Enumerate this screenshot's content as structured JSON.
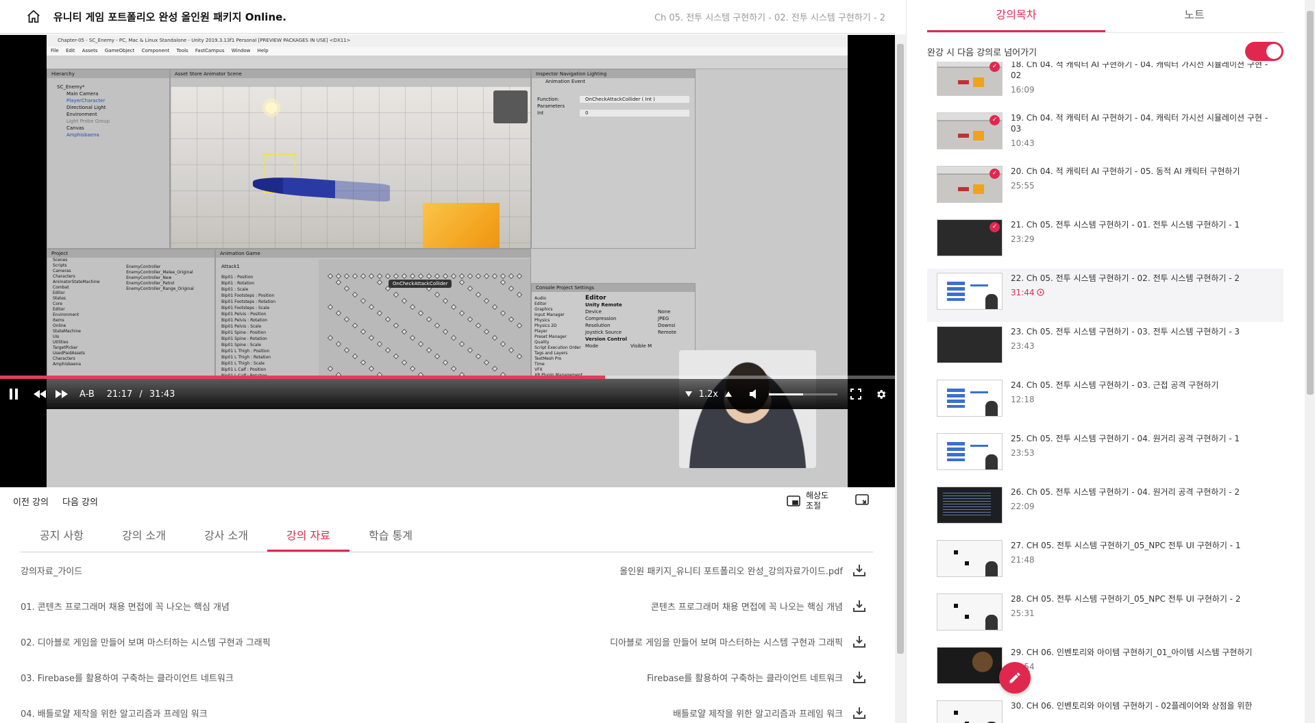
{
  "header": {
    "course_title": "유니티 게임 포트폴리오 완성 올인원 패키지 Online.",
    "lecture_crumb": "Ch 05. 전투 시스템 구현하기 - 02. 전투 시스템 구현하기 - 2"
  },
  "video": {
    "unity_title": "Chapter-05 - SC_Enemy - PC, Mac & Linux Standalone - Unity 2019.3.13f1 Personal [PREVIEW PACKAGES IN USE] <DX11>",
    "unity_menu": "File Edit Assets GameObject Component Tools FastCampus Window Help",
    "hierarchy_tab": "Hierarchy",
    "hierarchy_items": [
      "SC_Enemy*",
      "Main Camera",
      "PlayerCharacter",
      "Directional Light",
      "Environment",
      "Light Probe Group",
      "Canvas",
      "Amphisbaena"
    ],
    "scene_tabs": "Asset Store   Animator   Scene",
    "inspector_tabs": "Inspector   Navigation   Lighting",
    "inspector_title": "Animation Event",
    "inspector_function": "Function:",
    "inspector_function_value": "OnCheckAttackCollider ( Int )",
    "inspector_params": "Parameters",
    "inspector_int": "Int",
    "inspector_int_value": "0",
    "project_tab": "Project",
    "project_items": [
      "Scenes",
      "Scripts",
      "Cameras",
      "Characters",
      "AnimatorStateMachine",
      "Combat",
      "Editor",
      "States",
      "Core",
      "Editor",
      "Environment",
      "Items",
      "Online",
      "StateMachine",
      "UIs",
      "Utilities",
      "TargetPicker",
      "UsedPaidAssets",
      "Characters",
      "Amphisbaena"
    ],
    "search_results": [
      "EnemyController",
      "EnemyController_Melee_Original",
      "EnemyController_New",
      "EnemyController_Patrol",
      "EnemyController_Range_Original"
    ],
    "animation_tab": "Animation   Game",
    "animation_clip": "Attack1",
    "animation_tracks": [
      "Bip01 : Position",
      "Bip01 : Rotation",
      "Bip01 : Scale",
      "Bip01 Footsteps : Position",
      "Bip01 Footsteps : Rotation",
      "Bip01 Footsteps : Scale",
      "Bip01 Pelvis : Position",
      "Bip01 Pelvis : Rotation",
      "Bip01 Pelvis : Scale",
      "Bip01 Spine : Position",
      "Bip01 Spine : Rotation",
      "Bip01 Spine : Scale",
      "Bip01 L Thigh : Position",
      "Bip01 L Thigh : Rotation",
      "Bip01 L Thigh : Scale",
      "Bip01 L Calf : Position",
      "Bip01 L Calf : Rotation"
    ],
    "event_tooltip": "OnCheckAttackCollider",
    "settings_tabs": "Console   Project Settings",
    "settings_items": [
      "Audio",
      "Editor",
      "Graphics",
      "Input Manager",
      "Physics",
      "Physics 2D",
      "Player",
      "Preset Manager",
      "Quality",
      "Script Execution Order",
      "Tags and Layers",
      "TextMesh Pro",
      "Time",
      "VFX",
      "XR Plugin Management"
    ],
    "editor_heading": "Editor",
    "editor_unity_remote": "Unity Remote",
    "editor_labels": [
      "Device",
      "Compression",
      "Resolution",
      "Joystick Source"
    ],
    "editor_values": [
      "None",
      "JPEG",
      "Downsi",
      "Remote"
    ],
    "editor_version_control": "Version Control",
    "editor_mode": "Mode",
    "editor_mode_value": "Visible M"
  },
  "player": {
    "progress_fraction": 0.676,
    "ab_label": "A-B",
    "current_time": "21:17",
    "time_separator": "/",
    "total_time": "31:43",
    "speed": "1.2x",
    "volume_fraction": 0.5
  },
  "lecture_nav": {
    "prev_label": "이전 강의",
    "next_label": "다음 강의",
    "resolution_label": "해상도 조절"
  },
  "tabs": [
    {
      "label": "공지 사항",
      "active": false
    },
    {
      "label": "강의 소개",
      "active": false
    },
    {
      "label": "강사 소개",
      "active": false
    },
    {
      "label": "강의 자료",
      "active": true
    },
    {
      "label": "학습 통계",
      "active": false
    }
  ],
  "materials": [
    {
      "title": "강의자료_가이드",
      "file": "올인원 패키지_유니티 포트폴리오 완성_강의자료가이드.pdf"
    },
    {
      "title": "01. 콘텐츠 프로그래머 채용 면접에 꼭 나오는 핵심 개념",
      "file": "콘텐츠 프로그래머 채용 면접에 꼭 나오는 핵심 개념"
    },
    {
      "title": "02. 디아블로 게임을 만들어 보며 마스터하는 시스템 구현과 그래픽",
      "file": "디아블로 게임을 만들어 보며 마스터하는 시스템 구현과 그래픽"
    },
    {
      "title": "03. Firebase를 활용하여 구축하는 클라이언트 네트워크",
      "file": "Firebase를 활용하여 구축하는 클라이언트 네트워크"
    },
    {
      "title": "04. 배틀로얄 제작을 위한 알고리즘과 프레임 워크",
      "file": "배틀로얄 제작을 위한 알고리즘과 프레임 워크"
    }
  ],
  "sidebar": {
    "tab_toc": "강의목차",
    "tab_note": "노트",
    "autonext_label": "완강 시 다음 강의로 넘어가기",
    "autonext_on": true,
    "lectures": [
      {
        "title": "18. Ch 04. 적 캐릭터 AI 구현하기 - 04. 캐릭터 가시선 시뮬레이션 구현 - 02",
        "duration": "16:09",
        "done": true,
        "thumb": "th-unity"
      },
      {
        "title": "19. Ch 04. 적 캐릭터 AI 구현하기 - 04. 캐릭터 가시선 시뮬레이션 구현 - 03",
        "duration": "10:43",
        "done": true,
        "thumb": "th-unity"
      },
      {
        "title": "20. Ch 04. 적 캐릭터 AI 구현하기 - 05. 동적 AI 캐릭터 구현하기",
        "duration": "25:55",
        "done": true,
        "thumb": "th-unity"
      },
      {
        "title": "21. Ch 05. 전투 시스템 구현하기 - 01. 전투 시스템 구현하기 - 1",
        "duration": "23:29",
        "done": true,
        "thumb": "th-dark"
      },
      {
        "title": "22. Ch 05. 전투 시스템 구현하기 - 02. 전투 시스템 구현하기 - 2",
        "duration": "31:44",
        "done": false,
        "current": true,
        "thumb": "th-slide"
      },
      {
        "title": "23. Ch 05. 전투 시스템 구현하기 - 03. 전투 시스템 구현하기 - 3",
        "duration": "23:43",
        "done": false,
        "thumb": "th-dark"
      },
      {
        "title": "24. Ch 05. 전투 시스템 구현하기 - 03. 근접 공격 구현하기",
        "duration": "12:18",
        "done": false,
        "thumb": "th-slide"
      },
      {
        "title": "25. Ch 05. 전투 시스템 구현하기 - 04. 원거리 공격 구현하기 - 1",
        "duration": "23:53",
        "done": false,
        "thumb": "th-slide"
      },
      {
        "title": "26. Ch 05. 전투 시스템 구현하기 - 04. 원거리 공격 구현하기 - 2",
        "duration": "22:09",
        "done": false,
        "thumb": "th-code"
      },
      {
        "title": "27. CH 05. 전투 시스템 구현하기_05_NPC 전투 UI 구현하기 - 1",
        "duration": "21:48",
        "done": false,
        "thumb": "th-white"
      },
      {
        "title": "28. CH 05. 전투 시스템 구현하기_05_NPC 전투 UI 구현하기 - 2",
        "duration": "25:31",
        "done": false,
        "thumb": "th-white"
      },
      {
        "title": "29. CH 06. 인벤토리와 아이템 구현하기_01_아이템 시스템 구현하기",
        "duration": "30:54",
        "done": false,
        "thumb": "th-game"
      },
      {
        "title": "30. CH 06. 인벤토리와 아이템 구현하기 - 02플레이어와 상점을 위한",
        "duration": "",
        "done": false,
        "thumb": "th-white"
      }
    ]
  },
  "colors": {
    "accent": "#e0284f",
    "progress": "#e63b5b"
  },
  "icons": [
    "home-icon",
    "pause-icon",
    "rewind-icon",
    "forward-icon",
    "volume-icon",
    "fullscreen-icon",
    "settings-icon",
    "pip-icon",
    "wide-mode-icon",
    "download-icon",
    "check-icon",
    "play-circle-icon",
    "pencil-icon"
  ]
}
